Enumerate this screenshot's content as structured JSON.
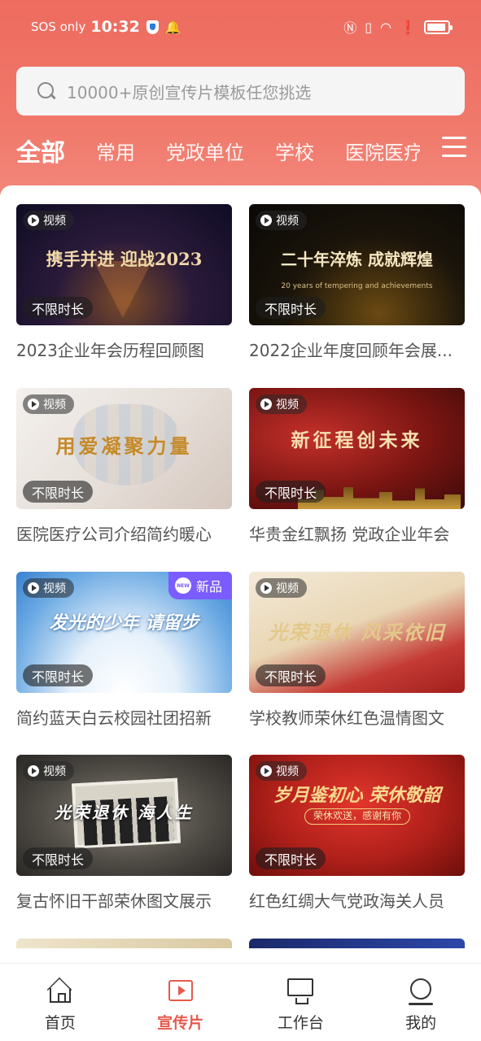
{
  "status": {
    "carrier": "SOS only",
    "time": "10:32",
    "icons": [
      "shield-icon",
      "bell-icon",
      "nfc-icon",
      "vibrate-icon",
      "wifi-icon",
      "alert-icon",
      "battery-icon"
    ]
  },
  "search": {
    "placeholder": "10000+原创宣传片模板任您挑选"
  },
  "tabs": [
    "全部",
    "常用",
    "党政单位",
    "学校",
    "医院医疗"
  ],
  "cards": [
    {
      "title": "2023企业年会历程回顾图",
      "badge": "视频",
      "duration": "不限时长",
      "headline": "携手并进 迎战2023"
    },
    {
      "title": "2022企业年度回顾年会展...",
      "badge": "视频",
      "duration": "不限时长",
      "headline": "二十年淬炼 成就辉煌",
      "sub": "20 years of tempering and achievements"
    },
    {
      "title": "医院医疗公司介绍简约暖心",
      "badge": "视频",
      "duration": "不限时长",
      "headline": "用爱凝聚力量"
    },
    {
      "title": "华贵金红飘扬 党政企业年会",
      "badge": "视频",
      "duration": "不限时长",
      "headline": "新征程创未来"
    },
    {
      "title": "简约蓝天白云校园社团招新",
      "badge": "视频",
      "duration": "不限时长",
      "headline": "发光的少年 请留步",
      "new": "新品"
    },
    {
      "title": "学校教师荣休红色温情图文",
      "badge": "视频",
      "duration": "不限时长",
      "headline": "光荣退休 风采依旧"
    },
    {
      "title": "复古怀旧干部荣休图文展示",
      "badge": "视频",
      "duration": "不限时长",
      "headline": "光荣退休 海人生"
    },
    {
      "title": "红色红绸大气党政海关人员",
      "badge": "视频",
      "duration": "不限时长",
      "headline": "岁月鉴初心 荣休敬韶",
      "sub": "荣休欢送，感谢有你"
    }
  ],
  "nav": [
    {
      "label": "首页",
      "icon": "home-icon"
    },
    {
      "label": "宣传片",
      "icon": "video-icon"
    },
    {
      "label": "工作台",
      "icon": "monitor-icon"
    },
    {
      "label": "我的",
      "icon": "profile-icon"
    }
  ]
}
